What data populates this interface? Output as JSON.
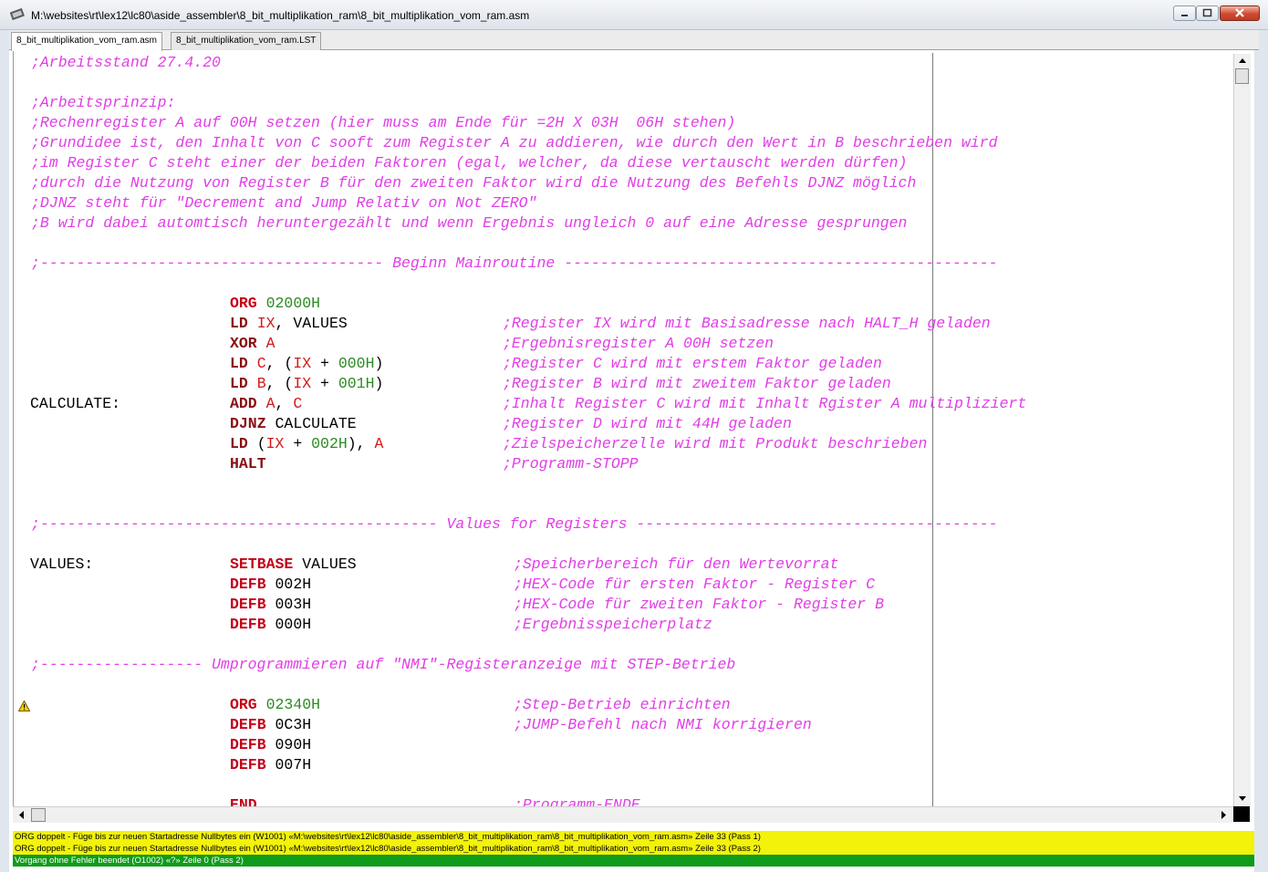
{
  "window": {
    "title": "M:\\websites\\rt\\lex12\\lc80\\aside_assembler\\8_bit_multiplikation_ram\\8_bit_multiplikation_vom_ram.asm",
    "app_icon": "assembler-icon",
    "buttons": [
      "minimize-icon",
      "maximize-icon",
      "close-icon"
    ]
  },
  "tabs": [
    {
      "label": "8_bit_multiplikation_vom_ram.asm",
      "active": true
    },
    {
      "label": "8_bit_multiplikation_vom_ram.LST",
      "active": false
    }
  ],
  "colors": {
    "comment": "#e13ee6",
    "keyword": "#c40018",
    "register": "#d41a1a",
    "number": "#2c8a24",
    "warning_bg": "#f2f20a",
    "ok_bg": "#0e9c1a"
  },
  "code": {
    "header": [
      ";Arbeitsstand 27.4.20",
      ";Arbeitsprinzip:",
      ";Rechenregister A auf 00H setzen (hier muss am Ende für =2H X 03H  06H stehen)",
      ";Grundidee ist, den Inhalt von C sooft zum Register A zu addieren, wie durch den Wert in B beschrieben wird",
      ";im Register C steht einer der beiden Faktoren (egal, welcher, da diese vertauscht werden dürfen)",
      ";durch die Nutzung von Register B für den zweiten Faktor wird die Nutzung des Befehls DJNZ möglich",
      ";DJNZ steht für \"Decrement and Jump Relativ on Not ZERO\"",
      ";B wird dabei automtisch heruntergezählt und wenn Ergebnis ungleich 0 auf eine Adresse gesprungen"
    ],
    "sections": {
      "main": ";-------------------------------------- Beginn Mainroutine ------------------------------------------------",
      "values": ";-------------------------------------------- Values for Registers ----------------------------------------",
      "nmi": ";------------------ Umprogrammieren auf \"NMI\"-Registeranzeige mit STEP-Betrieb"
    },
    "labels": {
      "calculate": "CALCULATE:",
      "values": "VALUES:"
    },
    "main_lines": [
      {
        "op": "ORG",
        "args": [
          {
            "t": "n",
            "v": "02000H"
          }
        ],
        "comment": ""
      },
      {
        "op": "LD",
        "args": [
          {
            "t": "r",
            "v": "IX"
          },
          {
            "t": "p",
            "v": ", VALUES"
          }
        ],
        "comment": ";Register IX wird mit Basisadresse nach HALT_H geladen"
      },
      {
        "op": "XOR",
        "args": [
          {
            "t": "r",
            "v": "A"
          }
        ],
        "comment": ";Ergebnisregister A 00H setzen"
      },
      {
        "op": "LD",
        "args": [
          {
            "t": "r",
            "v": "C"
          },
          {
            "t": "p",
            "v": ", ("
          },
          {
            "t": "r",
            "v": "IX"
          },
          {
            "t": "p",
            "v": " + "
          },
          {
            "t": "n",
            "v": "000H"
          },
          {
            "t": "p",
            "v": ")"
          }
        ],
        "comment": ";Register C wird mit erstem Faktor geladen"
      },
      {
        "op": "LD",
        "args": [
          {
            "t": "r",
            "v": "B"
          },
          {
            "t": "p",
            "v": ", ("
          },
          {
            "t": "r",
            "v": "IX"
          },
          {
            "t": "p",
            "v": " + "
          },
          {
            "t": "n",
            "v": "001H"
          },
          {
            "t": "p",
            "v": ")"
          }
        ],
        "comment": ";Register B wird mit zweitem Faktor geladen"
      },
      {
        "op": "ADD",
        "args": [
          {
            "t": "r",
            "v": "A"
          },
          {
            "t": "p",
            "v": ", "
          },
          {
            "t": "r",
            "v": "C"
          }
        ],
        "comment": ";Inhalt Register C wird mit Inhalt Rgister A multipliziert"
      },
      {
        "op": "DJNZ",
        "args": [
          {
            "t": "p",
            "v": "CALCULATE"
          }
        ],
        "comment": ";Register D wird mit 44H geladen"
      },
      {
        "op": "LD",
        "args": [
          {
            "t": "p",
            "v": "("
          },
          {
            "t": "r",
            "v": "IX"
          },
          {
            "t": "p",
            "v": " + "
          },
          {
            "t": "n",
            "v": "002H"
          },
          {
            "t": "p",
            "v": "), "
          },
          {
            "t": "r",
            "v": "A"
          }
        ],
        "comment": ";Zielspeicherzelle wird mit Produkt beschrieben"
      },
      {
        "op": "HALT",
        "args": [],
        "comment": ";Programm-STOPP"
      }
    ],
    "values_lines": [
      {
        "op": "SETBASE",
        "args": [
          {
            "t": "p",
            "v": "VALUES"
          }
        ],
        "comment": ";Speicherbereich für den Wertevorrat"
      },
      {
        "op": "DEFB",
        "args": [
          {
            "t": "p",
            "v": "002H"
          }
        ],
        "comment": ";HEX-Code für ersten Faktor - Register C"
      },
      {
        "op": "DEFB",
        "args": [
          {
            "t": "p",
            "v": "003H"
          }
        ],
        "comment": ";HEX-Code für zweiten Faktor - Register B"
      },
      {
        "op": "DEFB",
        "args": [
          {
            "t": "p",
            "v": "000H"
          }
        ],
        "comment": ";Ergebnisspeicherplatz"
      }
    ],
    "nmi_lines": [
      {
        "op": "ORG",
        "args": [
          {
            "t": "n",
            "v": "02340H"
          }
        ],
        "comment": ";Step-Betrieb einrichten"
      },
      {
        "op": "DEFB",
        "args": [
          {
            "t": "p",
            "v": "0C3H"
          }
        ],
        "comment": ";JUMP-Befehl nach NMI korrigieren"
      },
      {
        "op": "DEFB",
        "args": [
          {
            "t": "p",
            "v": "090H"
          }
        ],
        "comment": ""
      },
      {
        "op": "DEFB",
        "args": [
          {
            "t": "p",
            "v": "007H"
          }
        ],
        "comment": ""
      }
    ],
    "end_line": {
      "op": "END",
      "comment": ";Programm-ENDE"
    }
  },
  "status": [
    "ORG doppelt - Füge bis zur neuen Startadresse Nullbytes ein (W1001) «M:\\websites\\rt\\lex12\\lc80\\aside_assembler\\8_bit_multiplikation_ram\\8_bit_multiplikation_vom_ram.asm» Zeile 33 (Pass 1)",
    "ORG doppelt - Füge bis zur neuen Startadresse Nullbytes ein (W1001) «M:\\websites\\rt\\lex12\\lc80\\aside_assembler\\8_bit_multiplikation_ram\\8_bit_multiplikation_vom_ram.asm» Zeile 33 (Pass 2)",
    "Vorgang ohne Fehler beendet (O1002) «?» Zeile 0 (Pass 2)"
  ]
}
